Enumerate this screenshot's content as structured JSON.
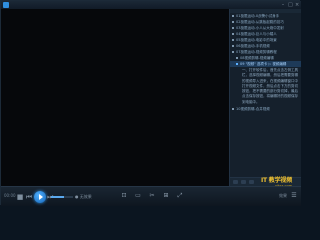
{
  "app": {
    "logo_icon": "app-logo-icon"
  },
  "window_buttons": [
    "–",
    "□",
    "×"
  ],
  "playlist": {
    "items": [
      {
        "label": "01极限运动-X战警小试身手",
        "sub": false
      },
      {
        "label": "02极限运动-从跳板起跳的技巧",
        "sub": false
      },
      {
        "label": "03极限运动-小人从大炮中发射",
        "sub": false
      },
      {
        "label": "04极限运动-巨人与小矮人",
        "sub": false
      },
      {
        "label": "05极限运动-电影中的场景",
        "sub": false
      },
      {
        "label": "06极限运动-手机视频",
        "sub": false
      },
      {
        "label": "07极限运动-视频剪辑教程",
        "sub": false
      },
      {
        "label": "08视频剪辑-视频编辑",
        "sub": true
      },
      {
        "label": "09 \"视频\" 选项卡 ▷ 视频编辑",
        "sub": true,
        "active": true
      }
    ],
    "text_block": "一、打开软件后，首先点击左侧工具栏，选择视频编辑，然后把需要剪辑的视频导入进来，在视频编辑窗口中打开视频文件，然后点击下方的剪切按钮，把不需要的部分剪切掉，最后点击保存按钮，将编辑好的视频保存到电脑中。",
    "last_item": "10视频剪辑-合并视频"
  },
  "controls": {
    "time": "00:00",
    "volume_label": "● 无效果",
    "volume_level": 0.6,
    "tool_icons": [
      "⊡",
      "▭",
      "✂",
      "⊞",
      "⤢"
    ],
    "right_label": "效果"
  },
  "watermark": {
    "logo": "IT 教学视频",
    "url": "yitxx.com"
  }
}
